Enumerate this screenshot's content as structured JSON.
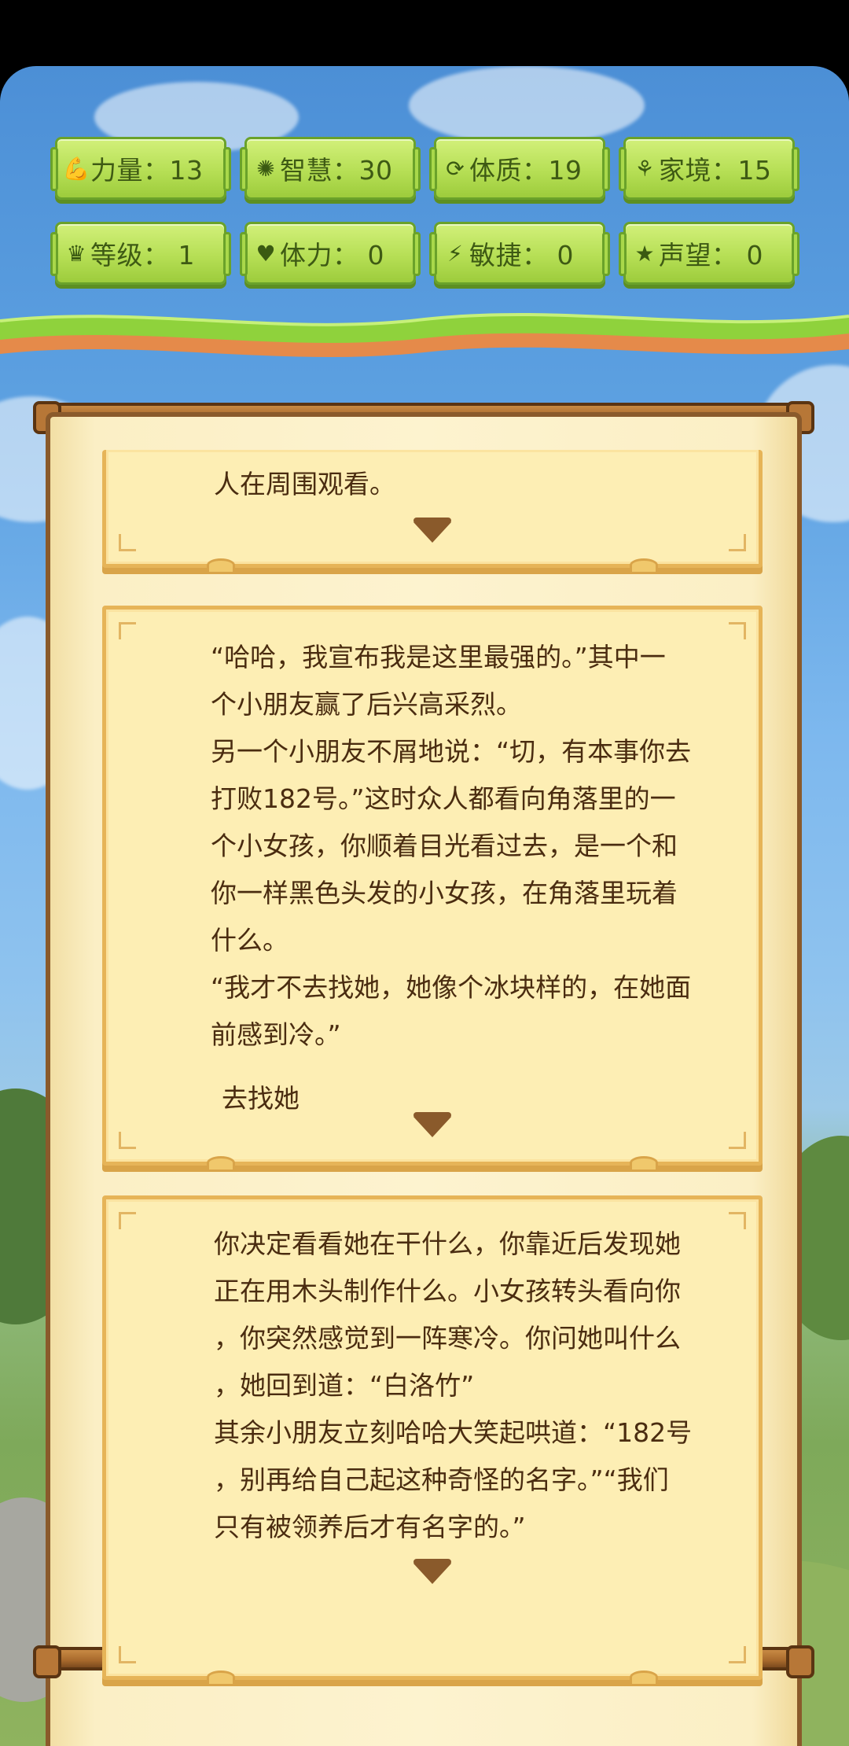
{
  "stats": [
    {
      "icon": "strength-icon",
      "glyph": "💪",
      "text": "力量：13"
    },
    {
      "icon": "wisdom-icon",
      "glyph": "✺",
      "text": "智慧：30"
    },
    {
      "icon": "constitution-icon",
      "glyph": "⟳",
      "text": "体质：19"
    },
    {
      "icon": "family-icon",
      "glyph": "⚘",
      "text": "家境：15"
    },
    {
      "icon": "crown-icon",
      "glyph": "♛",
      "text": "等级：  1"
    },
    {
      "icon": "heart-icon",
      "glyph": "♥",
      "text": "体力：  0"
    },
    {
      "icon": "lightning-icon",
      "glyph": "⚡",
      "text": "敏捷：  0"
    },
    {
      "icon": "star-icon",
      "glyph": "★",
      "text": "声望：  0"
    }
  ],
  "story": {
    "card1": {
      "lines": [
        "人在周围观看。"
      ]
    },
    "card2": {
      "lines": [
        "“哈哈，我宣布我是这里最强的。”其中一",
        "个小朋友赢了后兴高采烈。",
        "另一个小朋友不屑地说：“切，有本事你去",
        "打败182号。”这时众人都看向角落里的一",
        "个小女孩，你顺着目光看过去，是一个和",
        "你一样黑色头发的小女孩，在角落里玩着",
        "什么。",
        "“我才不去找她，她像个冰块样的，在她面",
        "前感到冷。”"
      ],
      "choice": "去找她"
    },
    "card3": {
      "lines": [
        "你决定看看她在干什么，你靠近后发现她",
        "正在用木头制作什么。小女孩转头看向你",
        "，你突然感觉到一阵寒冷。你问她叫什么",
        "，她回到道：“白洛竹”",
        "其余小朋友立刻哈哈大笑起哄道：“182号",
        "，别再给自己起这种奇怪的名字。”“我们",
        "只有被领养后才有名字的。”"
      ]
    }
  }
}
